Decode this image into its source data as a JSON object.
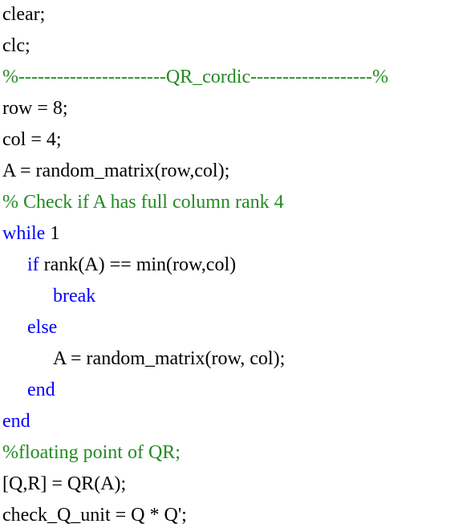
{
  "code": {
    "lines": [
      {
        "segments": [
          {
            "text": "clear;",
            "type": "tx"
          }
        ],
        "indent": 0
      },
      {
        "segments": [
          {
            "text": "clc;",
            "type": "tx"
          }
        ],
        "indent": 0
      },
      {
        "segments": [
          {
            "text": "%-----------------------QR_cordic-------------------%",
            "type": "cm"
          }
        ],
        "indent": 0
      },
      {
        "segments": [
          {
            "text": "row = 8;",
            "type": "tx"
          }
        ],
        "indent": 0
      },
      {
        "segments": [
          {
            "text": "col = 4;",
            "type": "tx"
          }
        ],
        "indent": 0
      },
      {
        "segments": [
          {
            "text": "A = random_matrix(row,col);",
            "type": "tx"
          }
        ],
        "indent": 0
      },
      {
        "segments": [
          {
            "text": "% Check if A has full column rank 4",
            "type": "cm"
          }
        ],
        "indent": 0
      },
      {
        "segments": [
          {
            "text": "while",
            "type": "kw"
          },
          {
            "text": " 1",
            "type": "tx"
          }
        ],
        "indent": 0
      },
      {
        "segments": [
          {
            "text": "if",
            "type": "kw"
          },
          {
            "text": " rank(A) == min(row,col)",
            "type": "tx"
          }
        ],
        "indent": 1
      },
      {
        "segments": [
          {
            "text": "break",
            "type": "kw"
          }
        ],
        "indent": 2
      },
      {
        "segments": [
          {
            "text": "else",
            "type": "kw"
          }
        ],
        "indent": 1
      },
      {
        "segments": [
          {
            "text": "A = random_matrix(row, col);",
            "type": "tx"
          }
        ],
        "indent": 2
      },
      {
        "segments": [
          {
            "text": "end",
            "type": "kw"
          }
        ],
        "indent": 1
      },
      {
        "segments": [
          {
            "text": "end",
            "type": "kw"
          }
        ],
        "indent": 0
      },
      {
        "segments": [
          {
            "text": "%floating point of QR;",
            "type": "cm"
          }
        ],
        "indent": 0
      },
      {
        "segments": [
          {
            "text": "[Q,R] = QR(A);",
            "type": "tx"
          }
        ],
        "indent": 0
      },
      {
        "segments": [
          {
            "text": "check_Q_unit = Q * Q';",
            "type": "tx"
          }
        ],
        "indent": 0
      }
    ]
  },
  "colors": {
    "keyword": "#0000ff",
    "comment": "#228b22",
    "text": "#000000",
    "background": "#ffffff"
  }
}
